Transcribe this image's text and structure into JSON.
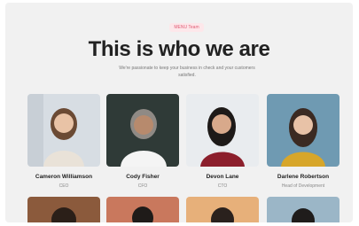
{
  "header": {
    "badge": "MENU Team",
    "title": "This is who we are",
    "subtitle": "We're passionate to keep your business in check and your customers satisfied."
  },
  "team": [
    {
      "name": "Cameron Williamson",
      "role": "CEO",
      "photo_bg": "#d7dde3",
      "hair": "#6b4a34",
      "shirt": "#e9e2d8",
      "skin": "#e9c3a6"
    },
    {
      "name": "Cody Fisher",
      "role": "CFO",
      "photo_bg": "#2f3a37",
      "hair": "#8f8a85",
      "shirt": "#f4f4f4",
      "skin": "#b78a6d"
    },
    {
      "name": "Devon Lane",
      "role": "CTO",
      "photo_bg": "#e9ecef",
      "hair": "#1e1a18",
      "shirt": "#8c1f2c",
      "skin": "#d8a98b"
    },
    {
      "name": "Darlene Robertson",
      "role": "Head of Development",
      "photo_bg": "#6f9ab2",
      "hair": "#3b2a22",
      "shirt": "#d7a62a",
      "skin": "#e8c2a7"
    }
  ],
  "second_row_colors": [
    "#8b5a3c",
    "#c9785d",
    "#e7b07a",
    "#9bb6c7"
  ]
}
